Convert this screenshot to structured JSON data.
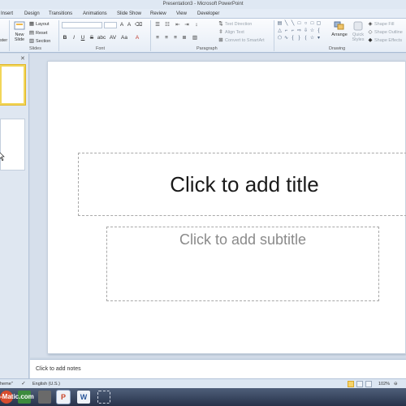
{
  "app": {
    "title": "Presentation3 - Microsoft PowerPoint"
  },
  "menu": {
    "tabs": [
      "Insert",
      "Design",
      "Transitions",
      "Animations",
      "Slide Show",
      "Review",
      "View",
      "Developer"
    ]
  },
  "ribbon": {
    "clipboard": {
      "paste_label": "ster"
    },
    "slides": {
      "group_label": "Slides",
      "new_slide_line1": "New",
      "new_slide_line2": "Slide",
      "layout_label": "Layout",
      "reset_label": "Reset",
      "section_label": "Section"
    },
    "font": {
      "group_label": "Font",
      "bold": "B",
      "italic": "I",
      "underline": "U",
      "strike": "S",
      "shadow": "abc",
      "spacing": "AV",
      "case": "Aa",
      "color": "A"
    },
    "paragraph": {
      "group_label": "Paragraph",
      "text_direction": "Text Direction",
      "align_text": "Align Text",
      "convert_smartart": "Convert to SmartArt"
    },
    "drawing": {
      "group_label": "Drawing",
      "arrange": "Arrange",
      "quick_styles_line1": "Quick",
      "quick_styles_line2": "Styles",
      "shape_fill": "Shape Fill",
      "shape_outline": "Shape Outline",
      "shape_effects": "Shape Effects"
    }
  },
  "slide": {
    "title_placeholder": "Click to add title",
    "subtitle_placeholder": "Click to add subtitle"
  },
  "notes": {
    "placeholder": "Click to add notes"
  },
  "status": {
    "theme": "heme\"",
    "language": "English (U.S.)",
    "zoom": "102%"
  },
  "taskbar": {
    "watermark": "-Matic.com"
  },
  "colors": {
    "selection_border": "#f2d65a",
    "ribbon_bg": "#e6edf6",
    "taskbar": "#27324a"
  }
}
